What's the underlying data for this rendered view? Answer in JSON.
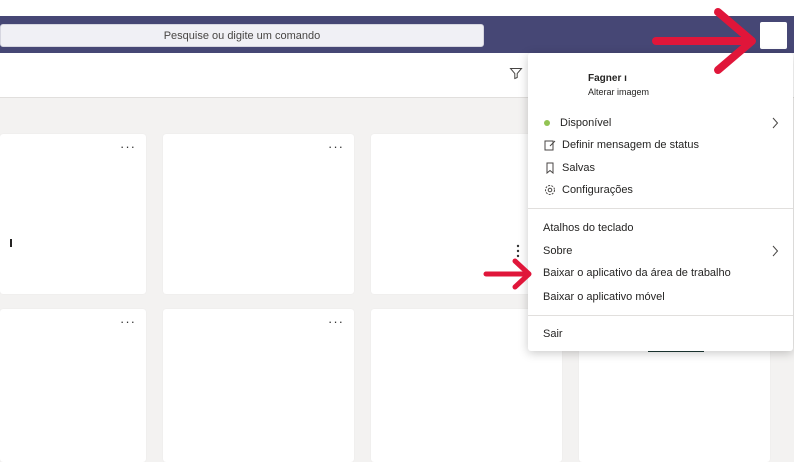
{
  "search": {
    "placeholder": "Pesquise ou digite um comando"
  },
  "card": {
    "more_label": "···"
  },
  "menu": {
    "user_name": "Fagner ı",
    "change_image": "Alterar imagem",
    "status": "Disponível",
    "set_status_message": "Definir mensagem de status",
    "saved": "Salvas",
    "settings": "Configurações",
    "keyboard_shortcuts": "Atalhos do teclado",
    "about": "Sobre",
    "download_desktop": "Baixar o aplicativo da área de trabalho",
    "download_mobile": "Baixar o aplicativo móvel",
    "sign_out": "Sair"
  },
  "colors": {
    "header": "#464775",
    "arrow": "#e0163a",
    "status_available": "#92c353"
  }
}
